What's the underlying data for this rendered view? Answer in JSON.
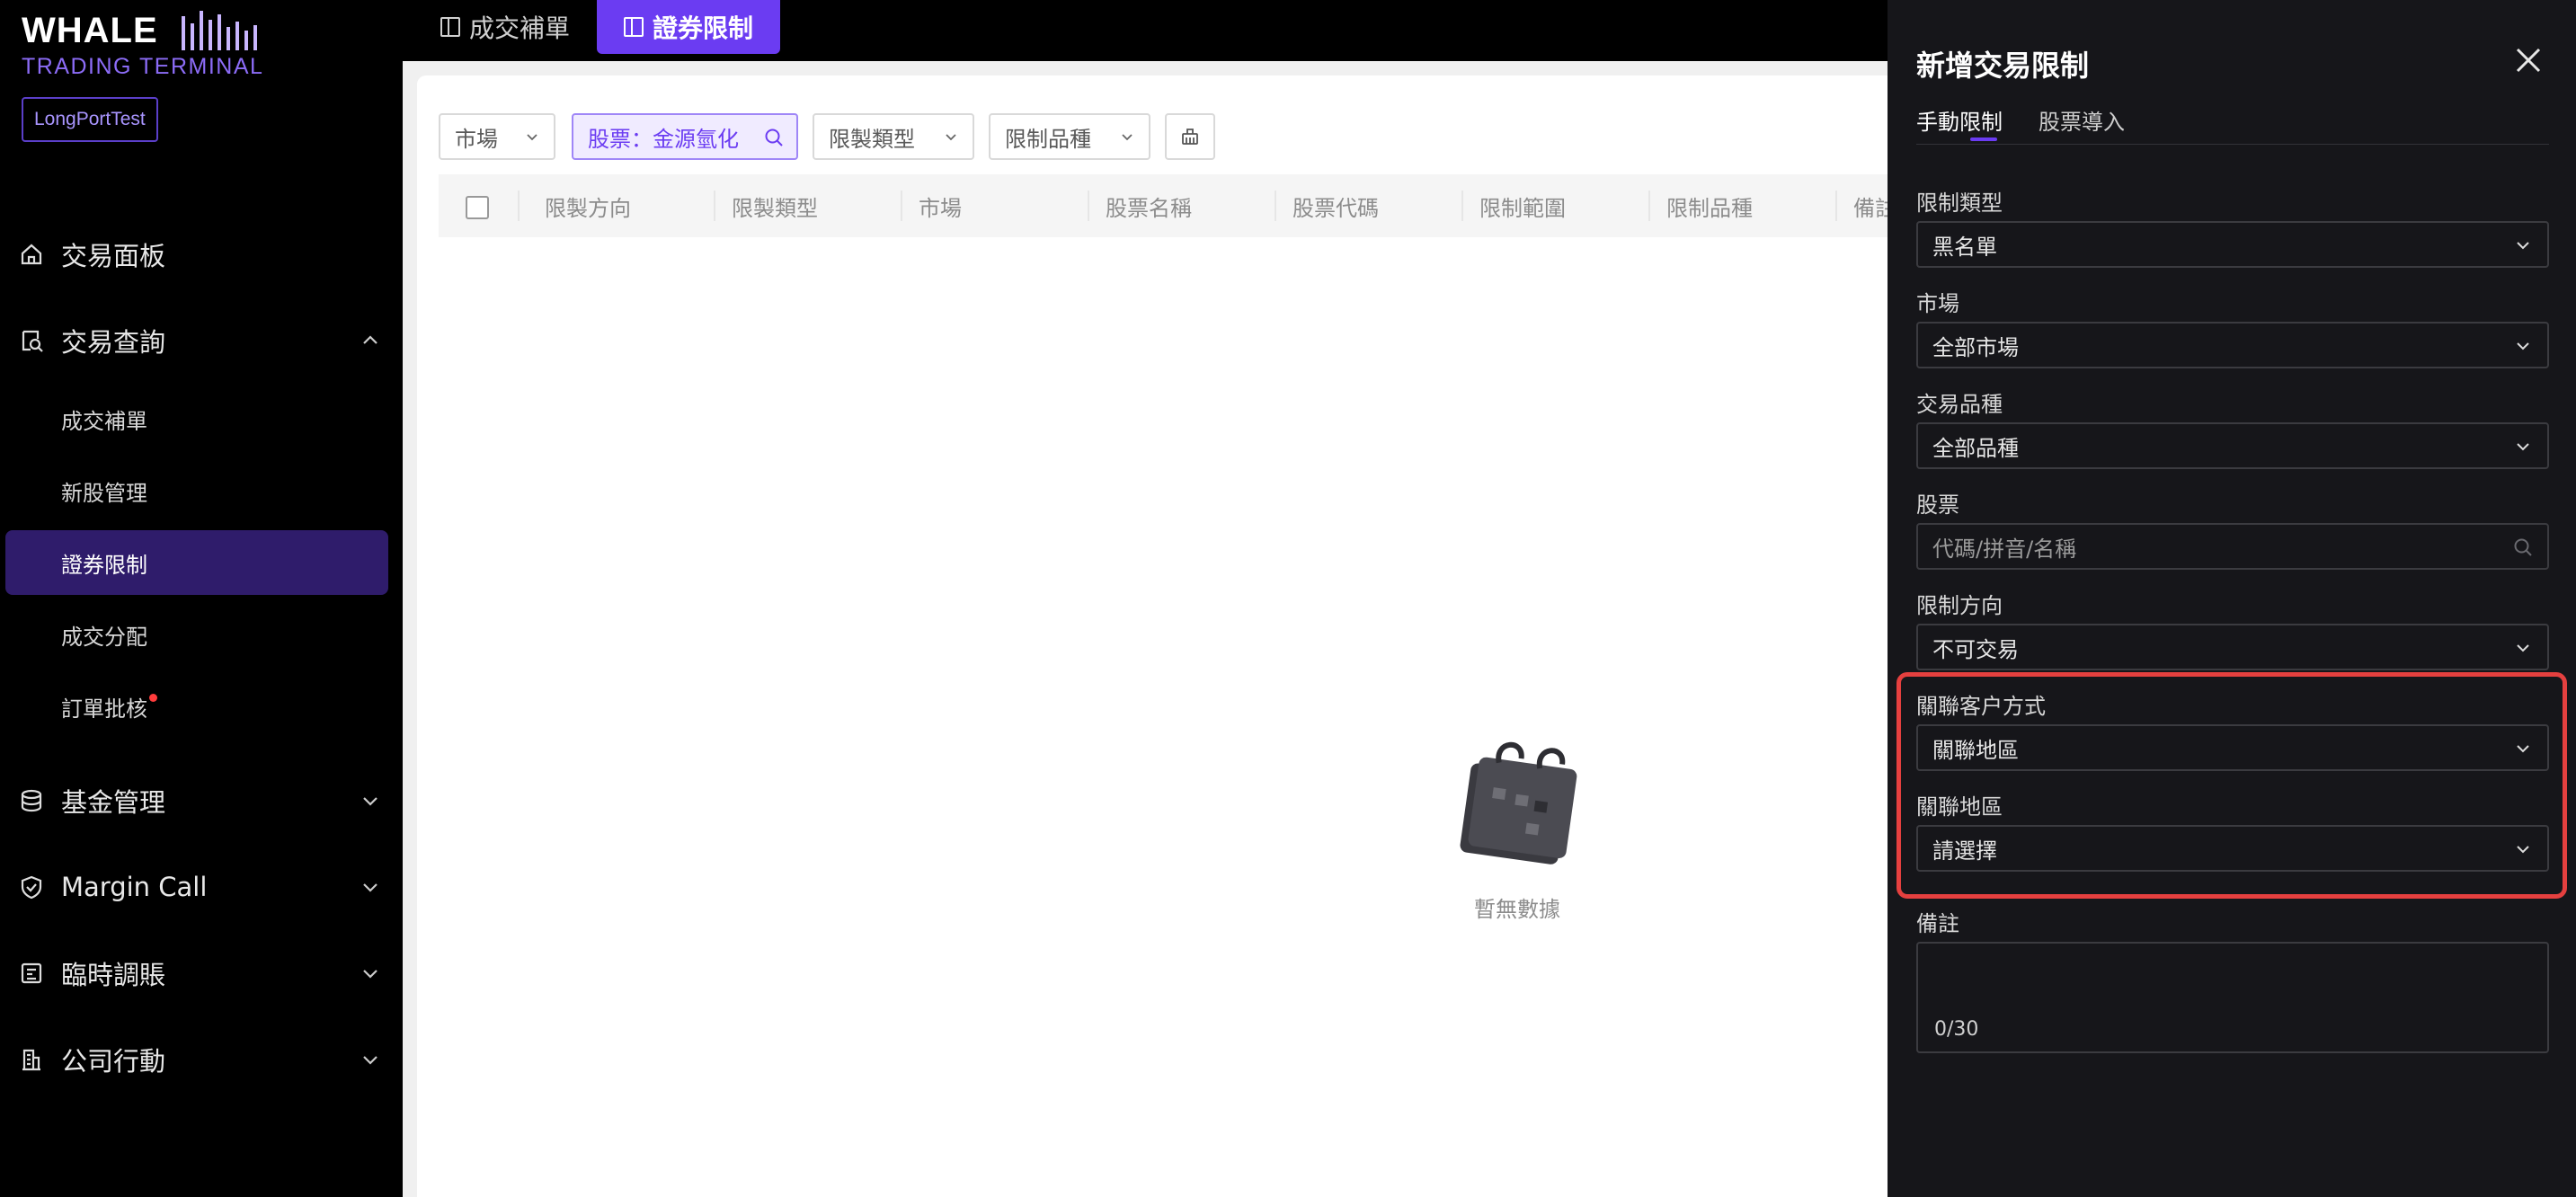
{
  "brand": {
    "name": "WHALE",
    "subtitle": "TRADING TERMINAL",
    "org": "LongPortTest",
    "colors": {
      "accent": "#6b3cf2",
      "accent_dark": "#2f1c6b",
      "highlight": "#e5403f"
    }
  },
  "sidebar": {
    "items": [
      {
        "label": "交易面板",
        "icon": "home-icon"
      },
      {
        "label": "交易查詢",
        "icon": "search-doc-icon",
        "expanded": true,
        "children": [
          {
            "label": "成交補單"
          },
          {
            "label": "新股管理"
          },
          {
            "label": "證券限制",
            "active": true
          },
          {
            "label": "成交分配"
          },
          {
            "label": "訂單批核",
            "badge_dot": true
          }
        ]
      },
      {
        "label": "基金管理",
        "icon": "database-icon"
      },
      {
        "label": "Margin Call",
        "icon": "shield-check-icon"
      },
      {
        "label": "臨時調賬",
        "icon": "ledger-icon"
      },
      {
        "label": "公司行動",
        "icon": "building-icon"
      }
    ]
  },
  "tabs": [
    {
      "label": "成交補單",
      "active": false
    },
    {
      "label": "證券限制",
      "active": true
    }
  ],
  "filters": {
    "market": "市場",
    "stock": "股票：金源氫化",
    "restrict_type": "限製類型",
    "restrict_product": "限制品種"
  },
  "table": {
    "columns": [
      "限製方向",
      "限製類型",
      "市場",
      "股票名稱",
      "股票代碼",
      "限制範圍",
      "限制品種",
      "備註"
    ],
    "rows": [],
    "empty_text": "暫無數據"
  },
  "drawer": {
    "title": "新增交易限制",
    "tabs": [
      {
        "label": "手動限制",
        "active": true
      },
      {
        "label": "股票導入",
        "active": false
      }
    ],
    "fields": {
      "restrict_type": {
        "label": "限制類型",
        "value": "黑名單"
      },
      "market": {
        "label": "市場",
        "value": "全部市場"
      },
      "product": {
        "label": "交易品種",
        "value": "全部品種"
      },
      "stock": {
        "label": "股票",
        "placeholder": "代碼/拼音/名稱"
      },
      "direction": {
        "label": "限制方向",
        "value": "不可交易"
      },
      "client_link_method": {
        "label": "關聯客户方式",
        "value": "關聯地區"
      },
      "region": {
        "label": "關聯地區",
        "placeholder": "請選擇"
      },
      "remark": {
        "label": "備註",
        "counter": "0/30"
      }
    }
  }
}
